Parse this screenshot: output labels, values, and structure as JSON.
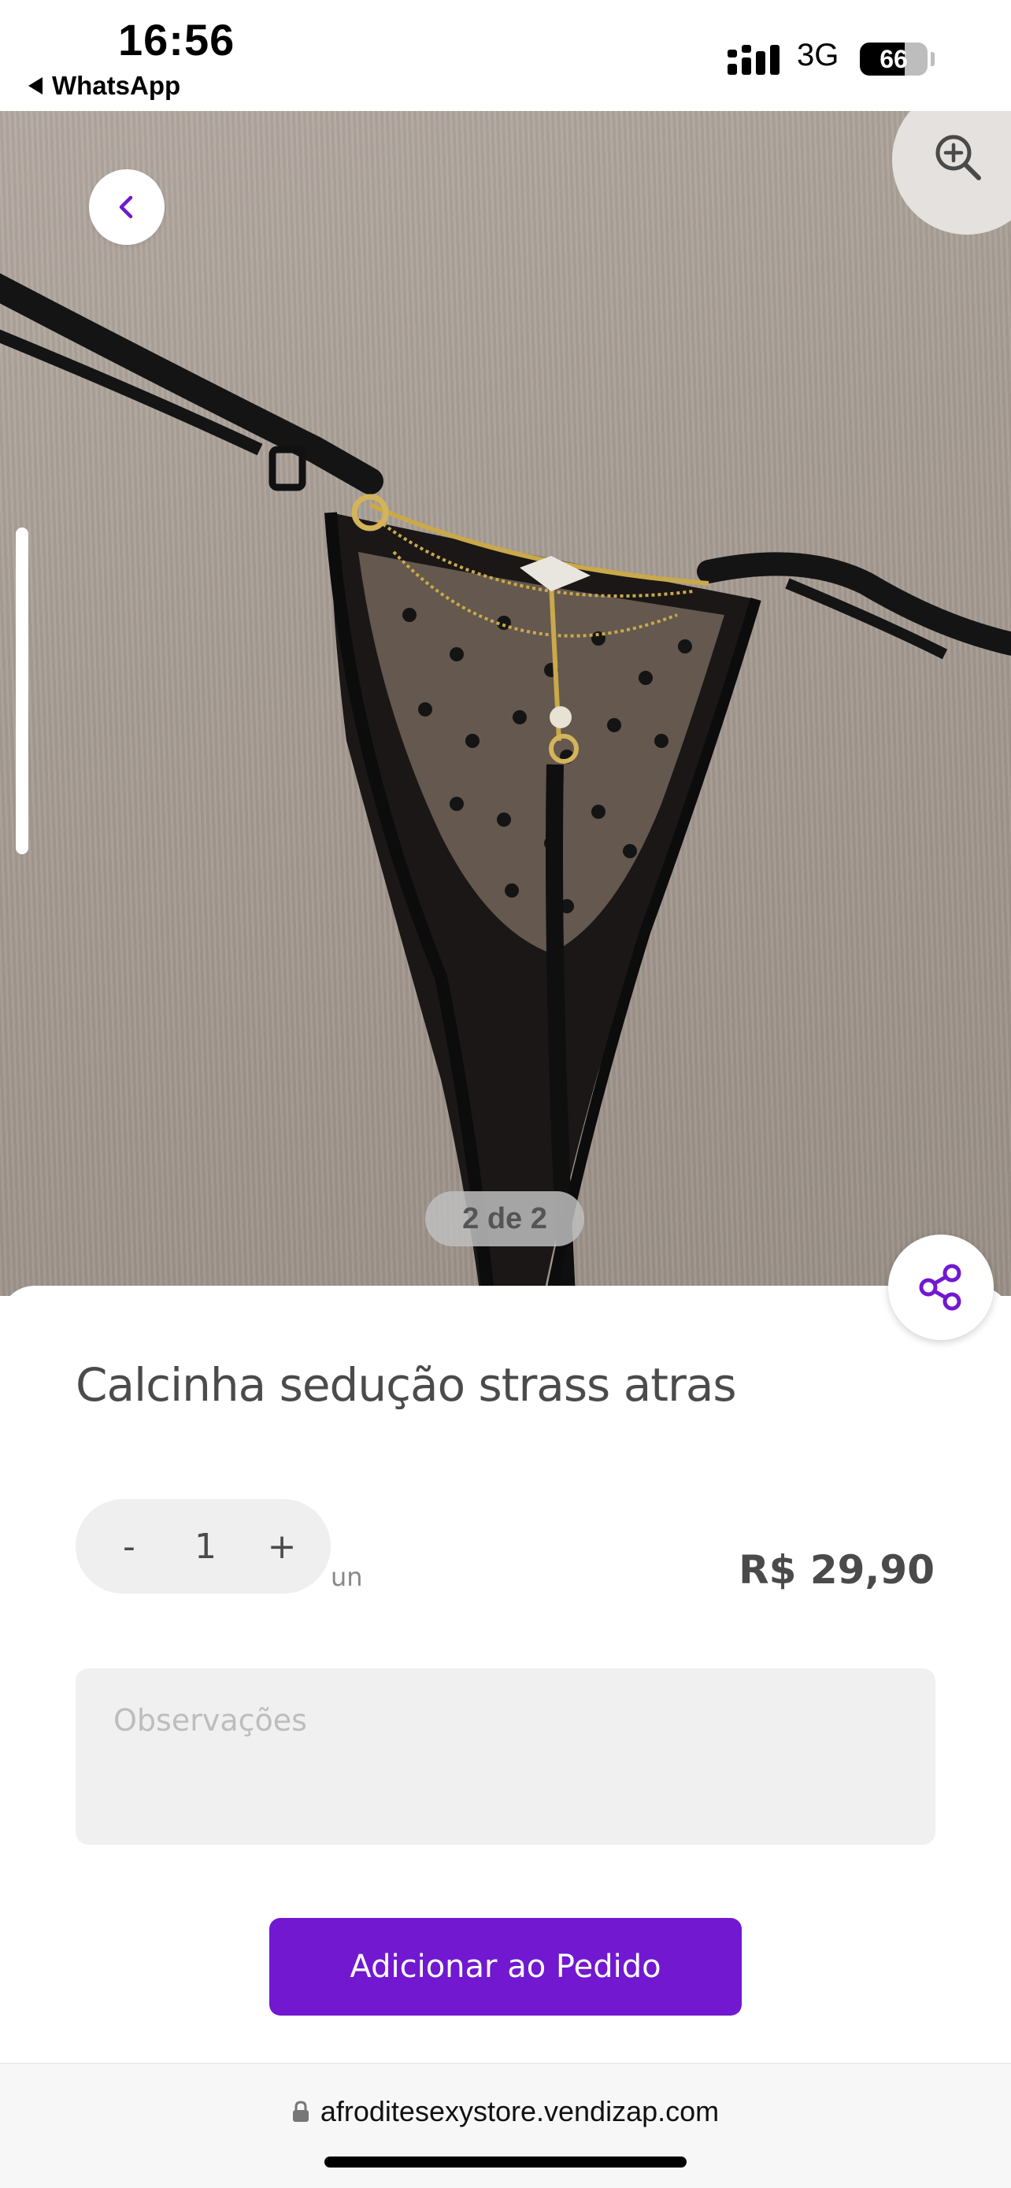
{
  "status_bar": {
    "time": "16:56",
    "back_app": "WhatsApp",
    "network": "3G",
    "battery": "66",
    "battery_level": 0.66
  },
  "gallery": {
    "counter": "2 de 2",
    "icons": {
      "back": "chevron-left-icon",
      "zoom": "zoom-in-icon",
      "share": "share-icon"
    }
  },
  "product": {
    "title": "Calcinha sedução strass atras",
    "quantity": {
      "decrement": "-",
      "value": "1",
      "increment": "+",
      "unit": "un"
    },
    "price": "R$ 29,90",
    "notes_placeholder": "Observações",
    "add_button": "Adicionar ao Pedido"
  },
  "browser": {
    "url": "afroditesexystore.vendizap.com"
  },
  "colors": {
    "accent": "#7118d0",
    "text": "#4a4a4a",
    "field_bg": "#f0f0f0"
  }
}
